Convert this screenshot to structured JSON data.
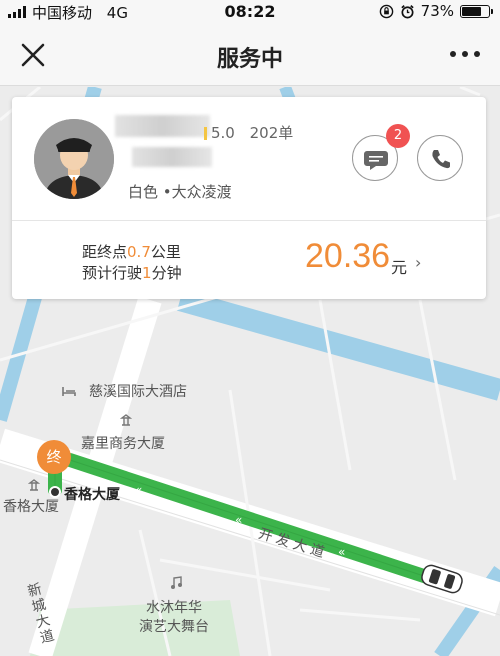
{
  "status_bar": {
    "carrier": "中国移动",
    "network": "4G",
    "time": "08:22",
    "battery_percent": "73%",
    "battery_level": 0.73
  },
  "nav": {
    "title": "服务中",
    "close_icon": "close-icon",
    "more_icon": "more-dots-icon"
  },
  "driver": {
    "rating": "5.0",
    "orders": "202单",
    "car_info": "白色 •大众凌渡",
    "message_badge": "2"
  },
  "trip": {
    "distance_prefix": "距终点",
    "distance_value": "0.7",
    "distance_unit": "公里",
    "time_prefix": "预计行驶",
    "time_value": "1",
    "time_unit": "分钟",
    "fare_value": "20.36",
    "fare_unit": "元",
    "fare_chevron": "›"
  },
  "map": {
    "end_marker": "终",
    "poi_hotel": "慈溪国际大酒店",
    "poi_jiali": "嘉里商务大厦",
    "poi_xiangge_dest": "香格大厦",
    "poi_xiangge_left": "香格大厦",
    "road_kaifa": "开发大道",
    "road_xincheng": "新城大道",
    "poi_stage_line1": "水沐年华",
    "poi_stage_line2": "演艺大舞台"
  },
  "colors": {
    "accent": "#f08c38",
    "route": "#3cb44b",
    "water": "#9fcfe8",
    "badge": "#f05252"
  }
}
